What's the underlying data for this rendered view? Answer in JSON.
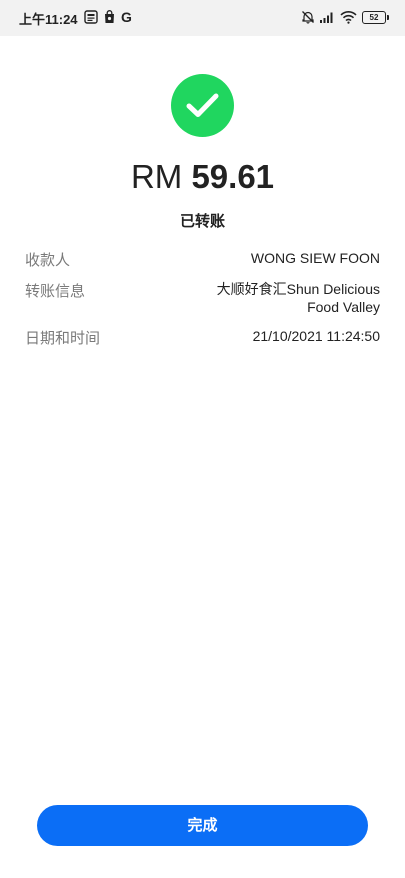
{
  "status_bar": {
    "time": "上午11:24",
    "notification_icons": [
      "news-app-icon",
      "shopping-bag-icon",
      "google-icon"
    ],
    "system_icons": [
      "muted-bell-icon",
      "signal-icon",
      "wifi-icon"
    ],
    "battery": "52"
  },
  "transfer": {
    "currency": "RM",
    "amount": "59.61",
    "status": "已转账",
    "status_color": "#20d65f"
  },
  "details": {
    "recipient_label": "收款人",
    "recipient_value": "WONG SIEW FOON",
    "info_label": "转账信息",
    "info_value_line1": "大顺好食汇Shun Delicious",
    "info_value_line2": "Food Valley",
    "datetime_label": "日期和时间",
    "datetime_value": "21/10/2021 11:24:50"
  },
  "actions": {
    "done_label": "完成",
    "done_color": "#0b6ef6"
  }
}
